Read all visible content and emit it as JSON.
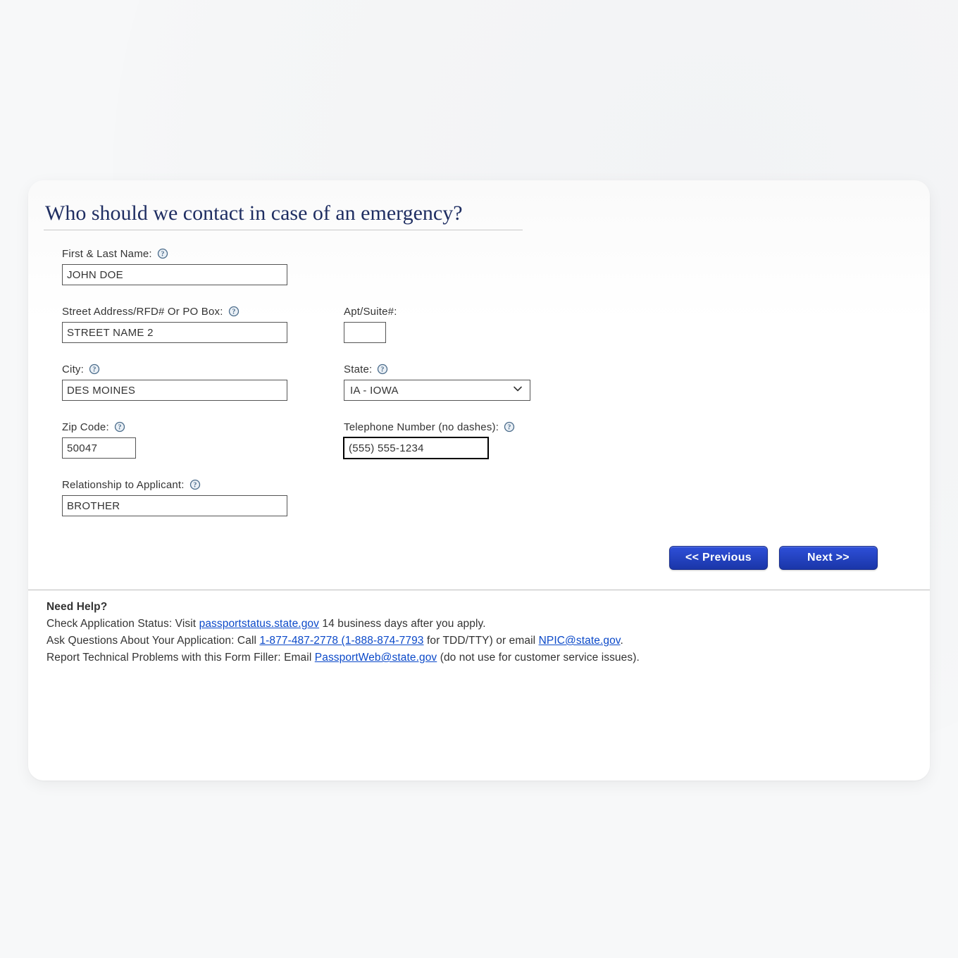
{
  "title": "Who should we contact in case of an emergency?",
  "fields": {
    "name": {
      "label": "First & Last Name:",
      "value": "JOHN DOE"
    },
    "street": {
      "label": "Street Address/RFD# Or PO Box:",
      "value": "STREET NAME 2"
    },
    "apt": {
      "label": "Apt/Suite#:",
      "value": ""
    },
    "city": {
      "label": "City:",
      "value": "DES MOINES"
    },
    "state": {
      "label": "State:",
      "value": "IA - IOWA"
    },
    "zip": {
      "label": "Zip Code:",
      "value": "50047"
    },
    "phone": {
      "label": "Telephone Number (no dashes):",
      "value": "(555) 555-1234"
    },
    "relationship": {
      "label": "Relationship to Applicant:",
      "value": "BROTHER"
    }
  },
  "nav": {
    "previous": "<<  Previous",
    "next": "Next  >>"
  },
  "help": {
    "heading": "Need Help?",
    "status_prefix": "Check Application Status: Visit ",
    "status_link": "passportstatus.state.gov",
    "status_suffix": " 14 business days after you apply.",
    "ask_prefix": "Ask Questions About Your Application: Call ",
    "ask_phone": "1-877-487-2778 (1-888-874-7793",
    "ask_mid": " for TDD/TTY) or email ",
    "ask_email": "NPIC@state.gov",
    "ask_suffix": ".",
    "tech_prefix": "Report Technical Problems with this Form Filler: Email ",
    "tech_email": "PassportWeb@state.gov",
    "tech_suffix": " (do not use for customer service issues)."
  }
}
